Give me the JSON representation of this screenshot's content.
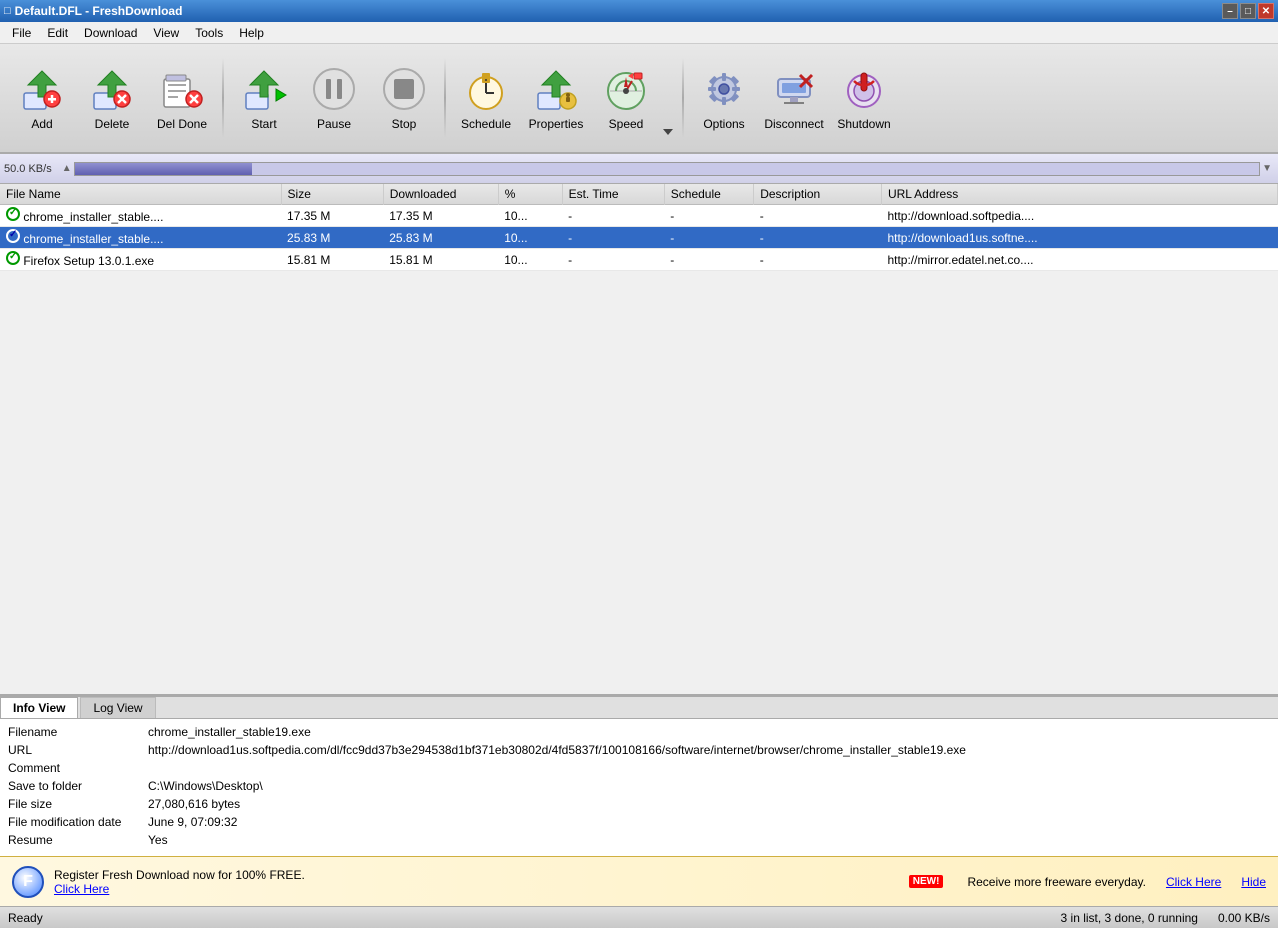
{
  "titleBar": {
    "title": "Default.DFL - FreshDownload",
    "icon": "fd"
  },
  "menuBar": {
    "items": [
      "File",
      "Edit",
      "Download",
      "View",
      "Tools",
      "Help"
    ]
  },
  "toolbar": {
    "buttons": [
      {
        "id": "add",
        "label": "Add"
      },
      {
        "id": "delete",
        "label": "Delete"
      },
      {
        "id": "deldone",
        "label": "Del Done"
      },
      {
        "id": "start",
        "label": "Start"
      },
      {
        "id": "pause",
        "label": "Pause"
      },
      {
        "id": "stop",
        "label": "Stop"
      },
      {
        "id": "schedule",
        "label": "Schedule"
      },
      {
        "id": "properties",
        "label": "Properties"
      },
      {
        "id": "speed",
        "label": "Speed"
      },
      {
        "id": "options",
        "label": "Options"
      },
      {
        "id": "disconnect",
        "label": "Disconnect"
      },
      {
        "id": "shutdown",
        "label": "Shutdown"
      }
    ]
  },
  "speedBar": {
    "label": "50.0 KB/s",
    "fillPercent": 15
  },
  "table": {
    "columns": [
      "File Name",
      "Size",
      "Downloaded",
      "%",
      "Est. Time",
      "Schedule",
      "Description",
      "URL Address"
    ],
    "colWidths": [
      "22%",
      "8%",
      "9%",
      "5%",
      "8%",
      "7%",
      "10%",
      "31%"
    ],
    "rows": [
      {
        "status": "done",
        "name": "chrome_installer_stable....",
        "size": "17.35 M",
        "downloaded": "17.35 M",
        "percent": "10...",
        "estTime": "-",
        "schedule": "-",
        "description": "-",
        "url": "http://download.softpedia...."
      },
      {
        "status": "done-selected",
        "name": "chrome_installer_stable....",
        "size": "25.83 M",
        "downloaded": "25.83 M",
        "percent": "10...",
        "estTime": "-",
        "schedule": "-",
        "description": "-",
        "url": "http://download1us.softne...."
      },
      {
        "status": "done",
        "name": "Firefox Setup 13.0.1.exe",
        "size": "15.81 M",
        "downloaded": "15.81 M",
        "percent": "10...",
        "estTime": "-",
        "schedule": "-",
        "description": "-",
        "url": "http://mirror.edatel.net.co...."
      }
    ]
  },
  "infoPanel": {
    "tabs": [
      "Info View",
      "Log View"
    ],
    "activeTab": "Info View",
    "fields": [
      {
        "label": "Filename",
        "value": "chrome_installer_stable19.exe"
      },
      {
        "label": "URL",
        "value": "http://download1us.softpedia.com/dl/fcc9dd37b3e294538d1bf371eb30802d/4fd5837f/100108166/software/internet/browser/chrome_installer_stable19.exe"
      },
      {
        "label": "Comment",
        "value": ""
      },
      {
        "label": "Save to folder",
        "value": "C:\\Windows\\Desktop\\"
      },
      {
        "label": "File size",
        "value": "27,080,616 bytes"
      },
      {
        "label": "File modification date",
        "value": "June 9, 07:09:32"
      },
      {
        "label": "Resume",
        "value": "Yes"
      }
    ]
  },
  "banner": {
    "leftText": "Register Fresh Download now for 100% FREE.",
    "leftLink": "Click Here",
    "rightBadge": "NEW!",
    "rightText": "Receive more freeware everyday.",
    "rightLink": "Click Here",
    "hideLabel": "Hide"
  },
  "statusBar": {
    "status": "Ready",
    "stats": "3 in list, 3 done, 0 running",
    "speed": "0.00 KB/s"
  }
}
